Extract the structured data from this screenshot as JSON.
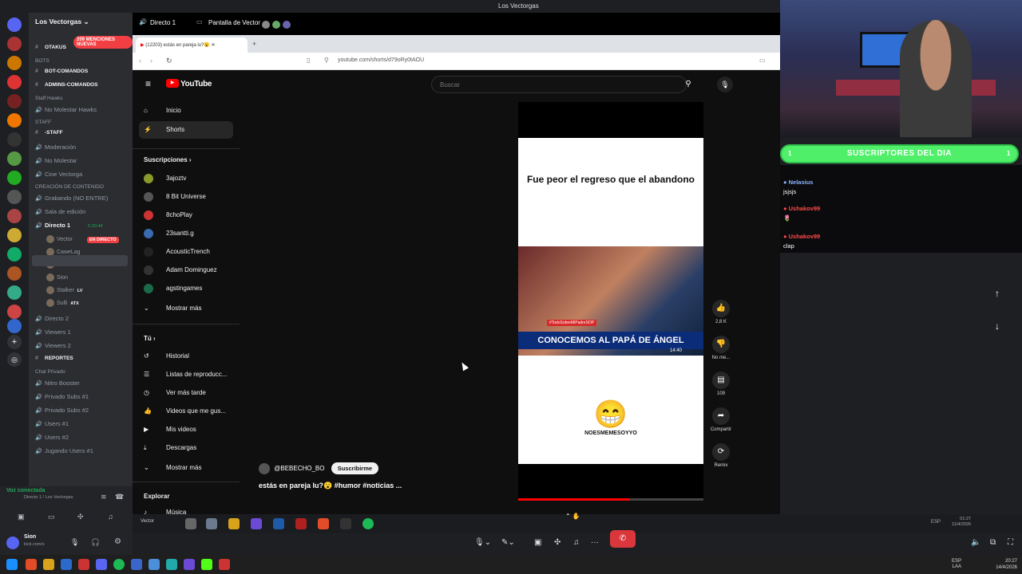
{
  "app": {
    "window_title": "Los Vectorgas"
  },
  "server": {
    "name": "Los Vectorgas",
    "mentions_badge": "209 MENCIONES NUEVAS"
  },
  "channels": [
    {
      "type": "text",
      "name": "OTAKUS",
      "bold": true
    },
    {
      "type": "category",
      "name": "BOTS"
    },
    {
      "type": "text",
      "name": "BOT-COMANDOS",
      "bold": true
    },
    {
      "type": "text",
      "name": "ADMINS-COMANDOS",
      "bold": true
    },
    {
      "type": "category",
      "name": "Staff Hawks"
    },
    {
      "type": "voice",
      "name": "No Molestar Hawks"
    },
    {
      "type": "category",
      "name": "STAFF"
    },
    {
      "type": "text",
      "name": "-STAFF",
      "bold": true
    },
    {
      "type": "voice",
      "name": "Moderación"
    },
    {
      "type": "voice",
      "name": "No Molestar"
    },
    {
      "type": "voice",
      "name": "Cine Vectorga"
    },
    {
      "type": "category",
      "name": "CREACIÓN DE CONTENIDO"
    },
    {
      "type": "voice",
      "name": "Grabando (NO ENTRE)"
    },
    {
      "type": "voice",
      "name": "Sala de edición"
    },
    {
      "type": "voice",
      "name": "Directo 1",
      "selected": true,
      "time": "5:20:44"
    }
  ],
  "voice_users": [
    {
      "name": "Vector",
      "badge": "EN DIRECTO"
    },
    {
      "name": "CaweLag",
      "badge": ""
    },
    {
      "name": "MadPat",
      "badge": "LV"
    },
    {
      "name": "Sion",
      "badge": ""
    },
    {
      "name": "Stalker",
      "badge": "LV"
    },
    {
      "name": "Sulli",
      "badge": "ATX"
    }
  ],
  "channels_after": [
    {
      "type": "voice",
      "name": "Directo 2"
    },
    {
      "type": "voice",
      "name": "Viewers 1"
    },
    {
      "type": "voice",
      "name": "Viewers 2"
    },
    {
      "type": "text",
      "name": "REPORTES",
      "bold": true
    },
    {
      "type": "category",
      "name": "Chat Privado"
    },
    {
      "type": "voice",
      "name": "Nitro Booster"
    },
    {
      "type": "voice",
      "name": "Privado Subs #1"
    },
    {
      "type": "voice",
      "name": "Privado Subs #2"
    },
    {
      "type": "voice",
      "name": "Users #1"
    },
    {
      "type": "voice",
      "name": "Users #2"
    },
    {
      "type": "voice",
      "name": "Jugando Users #1"
    }
  ],
  "voice_panel": {
    "status": "Voz conectada",
    "location": "Directo 1 / Los Vectorgas"
  },
  "user_panel": {
    "name": "Sion",
    "status": "kick.com/s"
  },
  "stream_header": {
    "channel": "Directo 1",
    "stream_name": "Pantalla de Vector"
  },
  "browser": {
    "tab_title": "(12203) estás en pareja lu?😮",
    "url": "youtube.com/shorts/d79oRy0tAOU"
  },
  "youtube": {
    "logo": "YouTube",
    "search_placeholder": "Buscar",
    "nav": [
      "Inicio",
      "Shorts"
    ],
    "subs_header": "Suscripciones",
    "subs": [
      "3ajoztv",
      "8 Bit Universe",
      "8choPlay",
      "23santti.g",
      "AcousticTrench",
      "Adam Dominguez",
      "agstingames"
    ],
    "show_more": "Mostrar más",
    "you_header": "Tú",
    "you_items": [
      "Historial",
      "Listas de reproducc...",
      "Ver más tarde",
      "Videos que me gus...",
      "Mis videos",
      "Descargas"
    ],
    "explore": "Explorar",
    "music": "Música",
    "short": {
      "caption": "Fue peor el regreso que el abandono",
      "tv_tag": "#TodoSobreMiPadreSOP",
      "tv_headline": "CONOCEMOS AL PAPÁ DE ÁNGEL",
      "tv_time": "14:40",
      "meme_tag": "NOESMEMESOYYO",
      "channel": "@BEBECHO_BO",
      "subscribe": "Suscribirme",
      "title": "estás en pareja lu?😮 #humor #noticias ..."
    },
    "actions": [
      {
        "icon": "like-icon",
        "label": "2,8 K"
      },
      {
        "icon": "dislike-icon",
        "label": "No me..."
      },
      {
        "icon": "comments-icon",
        "label": "109"
      },
      {
        "icon": "share-icon",
        "label": "Compartir"
      },
      {
        "icon": "remix-icon",
        "label": "Remix"
      }
    ]
  },
  "overlay": {
    "subs_banner": "SUSCRIPTORES DEL DIA",
    "subs_count_left": "1",
    "subs_count_right": "1",
    "chat": [
      {
        "user": "Nelasius",
        "message": "jsjsjs",
        "color": "#8ab4ff"
      },
      {
        "user": "Ushakov99",
        "message": "🌷",
        "color": "#ff4a4a"
      },
      {
        "user": "Ushakov99",
        "message": "clap",
        "color": "#ff4a4a"
      }
    ]
  },
  "taskbar": {
    "lang": "ESP",
    "region": "LAA",
    "time": "20:27",
    "date": "14/4/2026"
  },
  "stream_taskbar": {
    "label": "Vector",
    "time": "01:27",
    "date": "11/4/2026",
    "lang": "ESP"
  }
}
